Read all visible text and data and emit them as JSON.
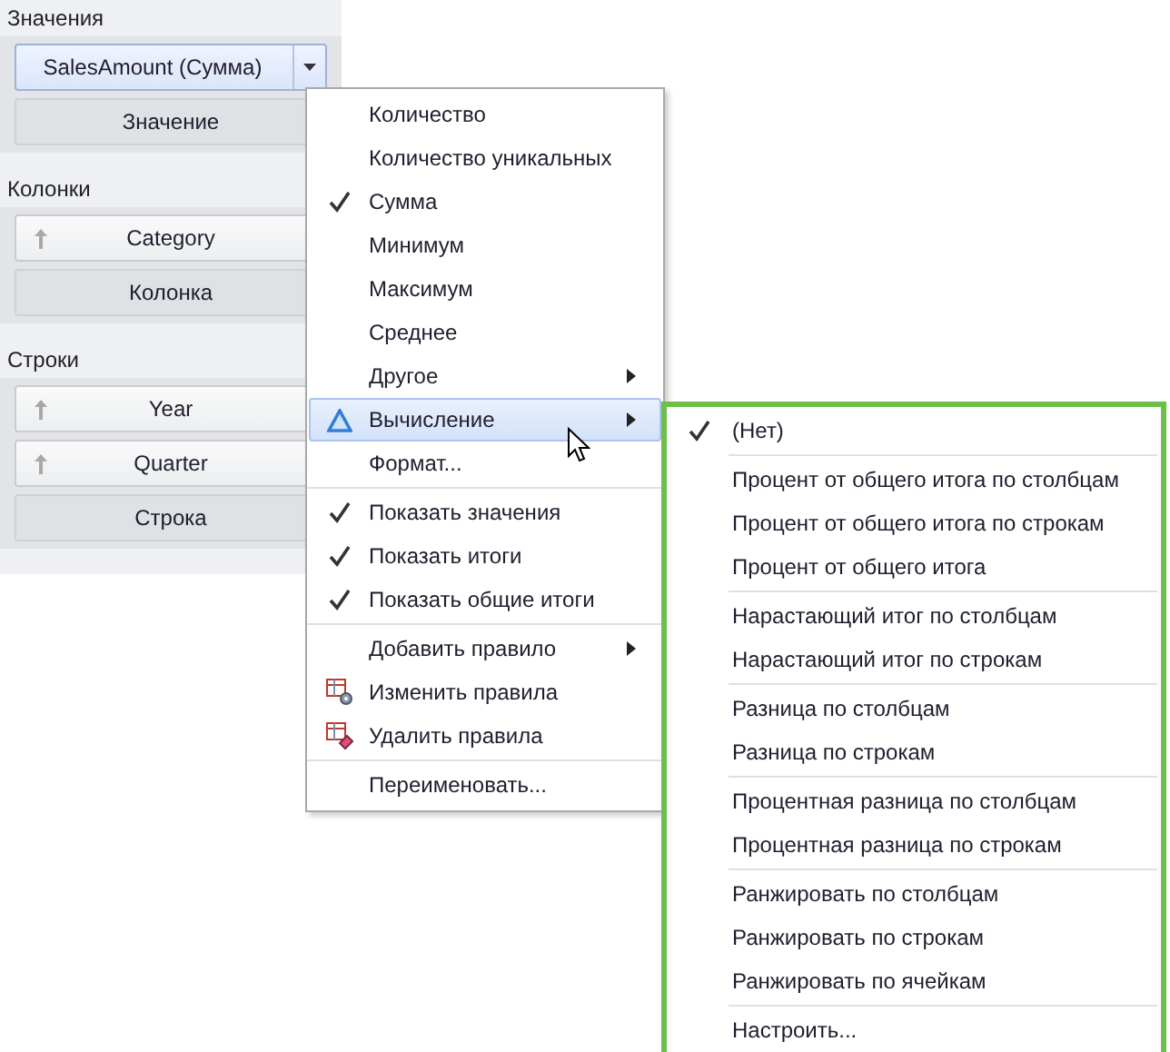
{
  "sections": [
    {
      "title": "Значения",
      "fields": [
        {
          "label": "SalesAmount (Сумма)",
          "kind": "field",
          "sort_arrow": false,
          "selected": true,
          "dropdown": true
        },
        {
          "label": "Значение",
          "kind": "placeholder",
          "sort_arrow": false,
          "selected": false,
          "dropdown": false
        }
      ]
    },
    {
      "title": "Колонки",
      "fields": [
        {
          "label": "Category",
          "kind": "field",
          "sort_arrow": true,
          "selected": false,
          "dropdown": false
        },
        {
          "label": "Колонка",
          "kind": "placeholder",
          "sort_arrow": false,
          "selected": false,
          "dropdown": false
        }
      ]
    },
    {
      "title": "Строки",
      "fields": [
        {
          "label": "Year",
          "kind": "field",
          "sort_arrow": true,
          "selected": false,
          "dropdown": false
        },
        {
          "label": "Quarter",
          "kind": "field",
          "sort_arrow": true,
          "selected": false,
          "dropdown": false
        },
        {
          "label": "Строка",
          "kind": "placeholder",
          "sort_arrow": false,
          "selected": false,
          "dropdown": false
        }
      ]
    }
  ],
  "menu": {
    "groups": [
      [
        {
          "label": "Количество",
          "kind": "plain",
          "checked": false,
          "submenu": false,
          "selected": false
        },
        {
          "label": "Количество уникальных",
          "kind": "plain",
          "checked": false,
          "submenu": false,
          "selected": false
        },
        {
          "label": "Сумма",
          "kind": "plain",
          "checked": true,
          "submenu": false,
          "selected": false
        },
        {
          "label": "Минимум",
          "kind": "plain",
          "checked": false,
          "submenu": false,
          "selected": false
        },
        {
          "label": "Максимум",
          "kind": "plain",
          "checked": false,
          "submenu": false,
          "selected": false
        },
        {
          "label": "Среднее",
          "kind": "plain",
          "checked": false,
          "submenu": false,
          "selected": false
        },
        {
          "label": "Другое",
          "kind": "plain",
          "checked": false,
          "submenu": true,
          "selected": false
        },
        {
          "label": "Вычисление",
          "kind": "calc",
          "checked": false,
          "submenu": true,
          "selected": true
        },
        {
          "label": "Формат...",
          "kind": "plain",
          "checked": false,
          "submenu": false,
          "selected": false
        }
      ],
      [
        {
          "label": "Показать значения",
          "kind": "plain",
          "checked": true,
          "submenu": false,
          "selected": false
        },
        {
          "label": "Показать итоги",
          "kind": "plain",
          "checked": true,
          "submenu": false,
          "selected": false
        },
        {
          "label": "Показать общие итоги",
          "kind": "plain",
          "checked": true,
          "submenu": false,
          "selected": false
        }
      ],
      [
        {
          "label": "Добавить правило",
          "kind": "plain",
          "checked": false,
          "submenu": true,
          "selected": false
        },
        {
          "label": "Изменить правила",
          "kind": "edit-rules",
          "checked": false,
          "submenu": false,
          "selected": false
        },
        {
          "label": "Удалить правила",
          "kind": "delete-rules",
          "checked": false,
          "submenu": false,
          "selected": false
        }
      ],
      [
        {
          "label": "Переименовать...",
          "kind": "plain",
          "checked": false,
          "submenu": false,
          "selected": false
        }
      ]
    ]
  },
  "submenu": {
    "groups": [
      [
        {
          "label": "(Нет)",
          "checked": true
        }
      ],
      [
        {
          "label": "Процент от общего итога по столбцам",
          "checked": false
        },
        {
          "label": "Процент от общего итога по строкам",
          "checked": false
        },
        {
          "label": "Процент от общего итога",
          "checked": false
        }
      ],
      [
        {
          "label": "Нарастающий итог по столбцам",
          "checked": false
        },
        {
          "label": "Нарастающий итог по строкам",
          "checked": false
        }
      ],
      [
        {
          "label": "Разница по столбцам",
          "checked": false
        },
        {
          "label": "Разница по строкам",
          "checked": false
        }
      ],
      [
        {
          "label": "Процентная разница по столбцам",
          "checked": false
        },
        {
          "label": "Процентная разница по строкам",
          "checked": false
        }
      ],
      [
        {
          "label": "Ранжировать по столбцам",
          "checked": false
        },
        {
          "label": "Ранжировать по строкам",
          "checked": false
        },
        {
          "label": "Ранжировать по ячейкам",
          "checked": false
        }
      ],
      [
        {
          "label": "Настроить...",
          "checked": false
        }
      ]
    ]
  }
}
